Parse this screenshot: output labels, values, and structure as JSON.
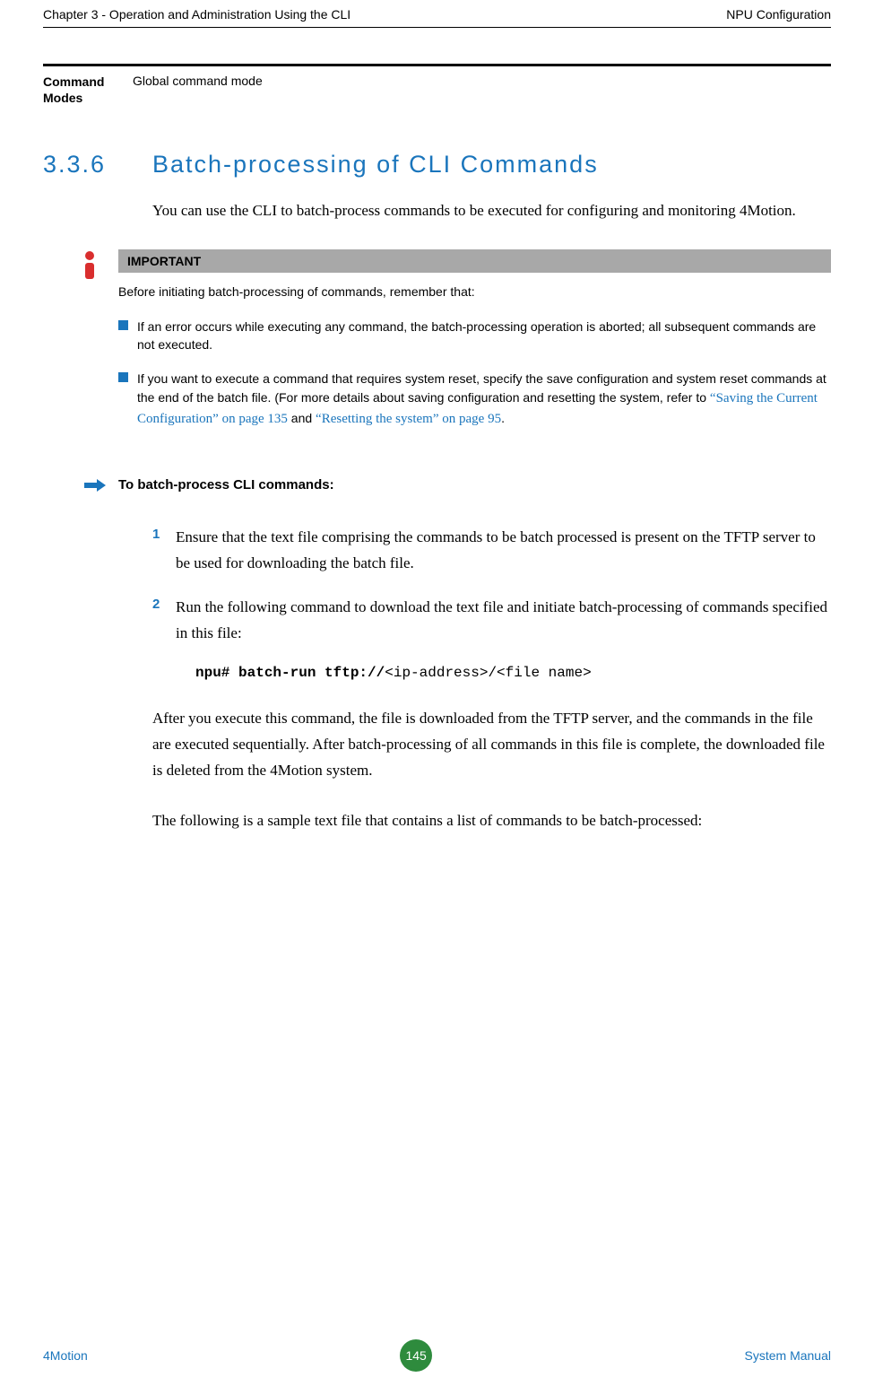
{
  "header": {
    "left": "Chapter 3 - Operation and Administration Using the CLI",
    "right": "NPU Configuration"
  },
  "command_modes": {
    "label": "Command Modes",
    "value": "Global command mode"
  },
  "section": {
    "number": "3.3.6",
    "title": "Batch-processing of CLI Commands"
  },
  "intro_paragraph": "You can use the CLI to batch-process commands to be executed for configuring and monitoring 4Motion.",
  "important": {
    "label": "IMPORTANT",
    "intro": "Before initiating batch-processing of commands, remember that:",
    "bullets": [
      {
        "text": "If an error occurs while executing any command, the batch-processing operation is aborted; all subsequent commands are not executed."
      },
      {
        "prefix": "If you want to execute a command that requires system reset, specify the save configuration and system reset commands at the end of the batch file. (For more details about saving configuration and resetting the system, refer to ",
        "link1": "“Saving the Current Configuration” on page 135",
        "mid": " and ",
        "link2": "“Resetting the system” on page 95",
        "suffix": "."
      }
    ]
  },
  "procedure": {
    "title": "To batch-process CLI commands:"
  },
  "steps": [
    {
      "num": "1",
      "text": "Ensure that the text file comprising the commands to be batch processed is present on the TFTP server to be used for downloading the batch file."
    },
    {
      "num": "2",
      "text": "Run the following command to download the text file and initiate batch-processing of commands specified in this file:"
    }
  ],
  "code": {
    "bold": "npu# batch-run tftp://",
    "rest": "<ip-address>/<file name>"
  },
  "after_para1": "After you execute this command, the file is downloaded from the TFTP server, and the commands in the file are executed sequentially. After batch-processing of all commands in this file is complete, the downloaded file is deleted from the 4Motion system.",
  "after_para2": "The following is a sample text file that contains a list of commands to be batch-processed:",
  "footer": {
    "left": "4Motion",
    "page": "145",
    "right": "System Manual"
  }
}
